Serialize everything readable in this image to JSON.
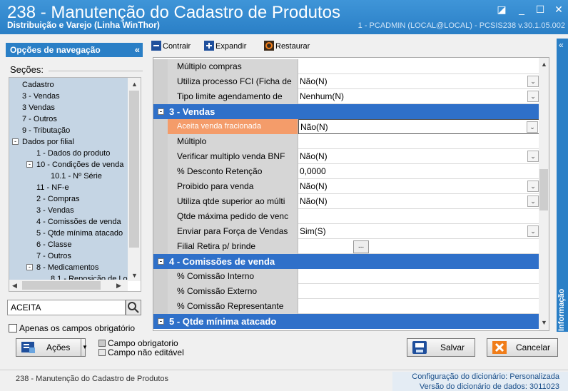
{
  "window": {
    "title": "238 - Manutenção do Cadastro de Produtos",
    "subtitle": "Distribuição e Varejo (Linha WinThor)",
    "connection": "1 - PCADMIN (LOCAL@LOCAL) - PCSIS238 v.30.1.05.002"
  },
  "nav": {
    "header": "Opções de navegação",
    "sections_label": "Seções:",
    "tree": [
      {
        "label": "Cadastro",
        "level": 0,
        "expander": ""
      },
      {
        "label": "3 - Vendas",
        "level": 0,
        "expander": ""
      },
      {
        "label": "3 Vendas",
        "level": 0,
        "expander": ""
      },
      {
        "label": "7 - Outros",
        "level": 0,
        "expander": ""
      },
      {
        "label": "9 - Tributação",
        "level": 0,
        "expander": ""
      },
      {
        "label": "Dados por filial",
        "level": 0,
        "expander": "-"
      },
      {
        "label": "1 - Dados do produto",
        "level": 1,
        "expander": ""
      },
      {
        "label": "10 - Condições de venda",
        "level": 1,
        "expander": "-"
      },
      {
        "label": "10.1 - Nº Série",
        "level": 2,
        "expander": ""
      },
      {
        "label": "11 - NF-e",
        "level": 1,
        "expander": ""
      },
      {
        "label": "2 - Compras",
        "level": 1,
        "expander": ""
      },
      {
        "label": "3 - Vendas",
        "level": 1,
        "expander": ""
      },
      {
        "label": "4 - Comissões de venda",
        "level": 1,
        "expander": ""
      },
      {
        "label": "5 - Qtde mínima atacado",
        "level": 1,
        "expander": ""
      },
      {
        "label": "6 - Classe",
        "level": 1,
        "expander": ""
      },
      {
        "label": "7 - Outros",
        "level": 1,
        "expander": ""
      },
      {
        "label": "8 - Medicamentos",
        "level": 1,
        "expander": "-"
      },
      {
        "label": "8.1 - Reposição de Lo",
        "level": 2,
        "expander": ""
      }
    ],
    "search_value": "ACEITA",
    "required_only_label": "Apenas os campos obrigatório"
  },
  "toolbar": {
    "collapse": "Contrair",
    "expand": "Expandir",
    "restore": "Restaurar"
  },
  "grid": {
    "rows": [
      {
        "kind": "field",
        "label": "Múltiplo compras",
        "value": "",
        "dropdown": false,
        "dots": false
      },
      {
        "kind": "field",
        "label": "Utiliza processo FCI (Ficha de",
        "value": "Não(N)",
        "dropdown": true,
        "dots": false
      },
      {
        "kind": "field",
        "label": "Tipo limite agendamento de",
        "value": "Nenhum(N)",
        "dropdown": true,
        "dots": false
      },
      {
        "kind": "category",
        "label": "3 - Vendas"
      },
      {
        "kind": "field",
        "label": "Aceita venda fracionada",
        "value": "Não(N)",
        "dropdown": true,
        "dots": false,
        "selected": true
      },
      {
        "kind": "field",
        "label": "Múltiplo",
        "value": "",
        "dropdown": false,
        "dots": false
      },
      {
        "kind": "field",
        "label": "Verificar multiplo venda BNF",
        "value": "Não(N)",
        "dropdown": true,
        "dots": false
      },
      {
        "kind": "field",
        "label": "% Desconto Retenção",
        "value": "0,0000",
        "dropdown": false,
        "dots": false
      },
      {
        "kind": "field",
        "label": "Proibido para venda",
        "value": "Não(N)",
        "dropdown": true,
        "dots": false
      },
      {
        "kind": "field",
        "label": "Utiliza qtde superior ao múlti",
        "value": "Não(N)",
        "dropdown": true,
        "dots": false
      },
      {
        "kind": "field",
        "label": "Qtde máxima pedido de venc",
        "value": "",
        "dropdown": false,
        "dots": false
      },
      {
        "kind": "field",
        "label": "Enviar para Força de Vendas",
        "value": "Sim(S)",
        "dropdown": true,
        "dots": false
      },
      {
        "kind": "field",
        "label": "Filial Retira p/ brinde",
        "value": "",
        "dropdown": false,
        "dots": true
      },
      {
        "kind": "category",
        "label": "4 - Comissões de venda"
      },
      {
        "kind": "field",
        "label": "% Comissão Interno",
        "value": "",
        "dropdown": false,
        "dots": false
      },
      {
        "kind": "field",
        "label": "% Comissão Externo",
        "value": "",
        "dropdown": false,
        "dots": false
      },
      {
        "kind": "field",
        "label": "% Comissão Representante",
        "value": "",
        "dropdown": false,
        "dots": false
      },
      {
        "kind": "category",
        "label": "5 - Qtde mínima atacado"
      }
    ],
    "dots_label": "..."
  },
  "side_tab": "Informação",
  "actions": {
    "actions_label": "Ações",
    "legend_required": "Campo obrigatorio",
    "legend_readonly": "Campo não editável",
    "save_label": "Salvar",
    "cancel_label": "Cancelar"
  },
  "status": {
    "left": "238 - Manutenção do Cadastro de Produtos",
    "dict_config_label": "Configuração do dicionário:",
    "dict_config_value": "Personalizada",
    "dict_version_label": "Versão do dicionário de dados:",
    "dict_version_value": "3011023"
  },
  "colors": {
    "accent": "#2a7fc6",
    "category": "#2f70c9",
    "selected_label": "#f49c6a",
    "tree_bg": "#c5d5e4"
  }
}
